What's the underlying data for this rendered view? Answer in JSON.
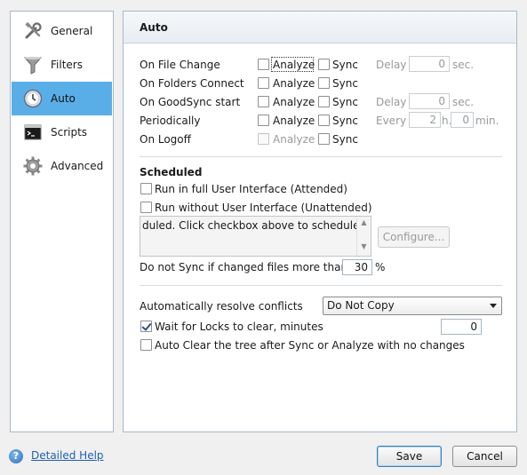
{
  "sidebar": {
    "items": [
      {
        "label": "General",
        "icon": "tools-icon"
      },
      {
        "label": "Filters",
        "icon": "funnel-icon"
      },
      {
        "label": "Auto",
        "icon": "clock-icon",
        "active": true
      },
      {
        "label": "Scripts",
        "icon": "terminal-icon"
      },
      {
        "label": "Advanced",
        "icon": "gear-icon"
      }
    ]
  },
  "panel": {
    "title": "Auto",
    "triggers": [
      {
        "label": "On File Change",
        "analyze": "Analyze",
        "sync": "Sync",
        "extra_label": "Delay",
        "value": "0",
        "unit": "sec."
      },
      {
        "label": "On Folders Connect",
        "analyze": "Analyze",
        "sync": "Sync"
      },
      {
        "label": "On GoodSync start",
        "analyze": "Analyze",
        "sync": "Sync",
        "extra_label": "Delay",
        "value": "0",
        "unit": "sec."
      },
      {
        "label": "Periodically",
        "analyze": "Analyze",
        "sync": "Sync",
        "extra_label": "Every",
        "value_h": "2",
        "unit_h": "h.",
        "value_min": "0",
        "unit_min": "min."
      },
      {
        "label": "On Logoff",
        "analyze": "Analyze",
        "sync": "Sync"
      }
    ],
    "scheduled": {
      "title": "Scheduled",
      "attended_label": "Run in full User Interface (Attended)",
      "unattended_label": "Run without User Interface (Unattended)",
      "schedule_text": "duled. Click checkbox above to schedule",
      "configure_label": "Configure...",
      "no_sync_label": "Do not Sync if changed files more than",
      "no_sync_value": "30",
      "no_sync_unit": "%"
    },
    "conflicts": {
      "label": "Automatically resolve conflicts",
      "selected": "Do Not Copy",
      "wait_locks_label": "Wait for Locks to clear, minutes",
      "wait_locks_checked": true,
      "wait_locks_value": "0",
      "auto_clear_label": "Auto Clear the tree after Sync or Analyze with no changes"
    }
  },
  "footer": {
    "help_label": "Detailed Help",
    "save_label": "Save",
    "cancel_label": "Cancel"
  },
  "colors": {
    "active_nav": "#5aaee8",
    "link": "#1f5fb3",
    "border": "#a9b8c8"
  }
}
